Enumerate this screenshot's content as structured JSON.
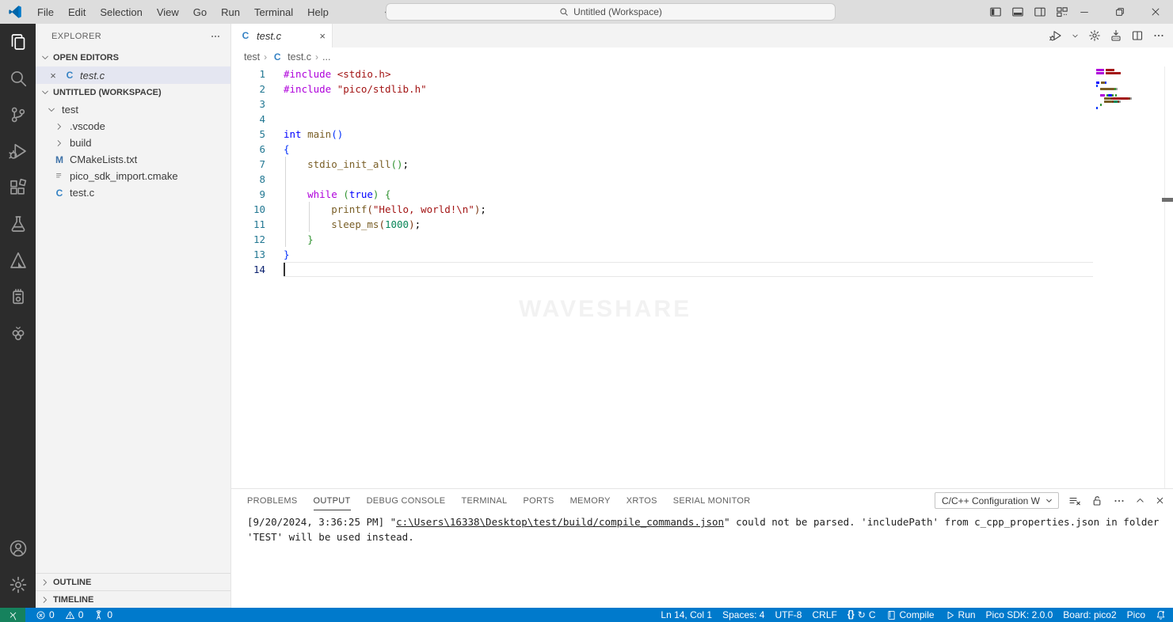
{
  "window": {
    "menus": [
      "File",
      "Edit",
      "Selection",
      "View",
      "Go",
      "Run",
      "Terminal",
      "Help"
    ],
    "search_label": "Untitled (Workspace)",
    "layout_icons": [
      "layout-sidebar-left",
      "layout-panel",
      "layout-sidebar-right",
      "layout-customize"
    ],
    "window_controls": [
      "minimize",
      "restore",
      "close"
    ]
  },
  "activity_bar": {
    "top": [
      {
        "name": "explorer",
        "icon": "files",
        "active": true
      },
      {
        "name": "search",
        "icon": "search",
        "active": false
      },
      {
        "name": "source-control",
        "icon": "git",
        "active": false
      },
      {
        "name": "run-and-debug",
        "icon": "debug",
        "active": false
      },
      {
        "name": "extensions",
        "icon": "extensions",
        "active": false
      },
      {
        "name": "testing",
        "icon": "beaker",
        "active": false
      },
      {
        "name": "cmake",
        "icon": "cmake",
        "active": false
      },
      {
        "name": "mcu-tools",
        "icon": "chip",
        "active": false
      },
      {
        "name": "raspberry-pi-pico",
        "icon": "raspberry",
        "active": false
      }
    ],
    "bottom": [
      {
        "name": "accounts",
        "icon": "account"
      },
      {
        "name": "manage",
        "icon": "gear"
      }
    ]
  },
  "sidebar": {
    "title": "EXPLORER",
    "open_editors_header": "OPEN EDITORS",
    "open_editors": [
      {
        "label": "test.c",
        "icon": "c",
        "selected": true
      }
    ],
    "workspace_header": "UNTITLED (WORKSPACE)",
    "tree": [
      {
        "label": "test",
        "type": "folder",
        "expanded": true,
        "depth": 0
      },
      {
        "label": ".vscode",
        "type": "folder",
        "expanded": false,
        "depth": 1
      },
      {
        "label": "build",
        "type": "folder",
        "expanded": false,
        "depth": 1
      },
      {
        "label": "CMakeLists.txt",
        "icon": "m",
        "depth": 1
      },
      {
        "label": "pico_sdk_import.cmake",
        "icon": "doc",
        "depth": 1
      },
      {
        "label": "test.c",
        "icon": "c",
        "depth": 1
      }
    ],
    "bottom_sections": [
      "OUTLINE",
      "TIMELINE"
    ]
  },
  "editor": {
    "tab": {
      "label": "test.c"
    },
    "toolbar_icons": [
      "debug-run",
      "chevron-down-small",
      "gear",
      "flash",
      "split-editor",
      "more"
    ],
    "breadcrumb": [
      "test",
      "test.c",
      "..."
    ],
    "watermark": "WAVESHARE",
    "syntax_colors": {
      "pp": "#af00db",
      "kw": "#0000ff",
      "fn": "#795e26",
      "str": "#a31515",
      "num": "#098658",
      "pl": "#000000",
      "b1": "#0431fa",
      "b2": "#319331",
      "b3": "#7b3814"
    },
    "lines": [
      {
        "n": 1,
        "t": [
          [
            "pp",
            "#include"
          ],
          [
            "pl",
            " "
          ],
          [
            "str",
            "<stdio.h>"
          ]
        ]
      },
      {
        "n": 2,
        "t": [
          [
            "pp",
            "#include"
          ],
          [
            "pl",
            " "
          ],
          [
            "str",
            "\"pico/stdlib.h\""
          ]
        ]
      },
      {
        "n": 3,
        "t": []
      },
      {
        "n": 4,
        "t": []
      },
      {
        "n": 5,
        "t": [
          [
            "kw",
            "int"
          ],
          [
            "pl",
            " "
          ],
          [
            "fn",
            "main"
          ],
          [
            "b1",
            "()"
          ]
        ]
      },
      {
        "n": 6,
        "t": [
          [
            "b1",
            "{"
          ]
        ]
      },
      {
        "n": 7,
        "t": [
          [
            "pl",
            "    "
          ],
          [
            "fn",
            "stdio_init_all"
          ],
          [
            "b2",
            "()"
          ],
          [
            "pl",
            ";"
          ]
        ],
        "g": [
          0
        ]
      },
      {
        "n": 8,
        "t": [],
        "g": [
          0
        ]
      },
      {
        "n": 9,
        "t": [
          [
            "pl",
            "    "
          ],
          [
            "pp",
            "while"
          ],
          [
            "pl",
            " "
          ],
          [
            "b2",
            "("
          ],
          [
            "kw",
            "true"
          ],
          [
            "b2",
            ")"
          ],
          [
            "pl",
            " "
          ],
          [
            "b2",
            "{"
          ]
        ],
        "g": [
          0
        ]
      },
      {
        "n": 10,
        "t": [
          [
            "pl",
            "        "
          ],
          [
            "fn",
            "printf"
          ],
          [
            "b3",
            "("
          ],
          [
            "str",
            "\"Hello, world!\\n\""
          ],
          [
            "b3",
            ")"
          ],
          [
            "pl",
            ";"
          ]
        ],
        "g": [
          0,
          1
        ]
      },
      {
        "n": 11,
        "t": [
          [
            "pl",
            "        "
          ],
          [
            "fn",
            "sleep_ms"
          ],
          [
            "b3",
            "("
          ],
          [
            "num",
            "1000"
          ],
          [
            "b3",
            ")"
          ],
          [
            "pl",
            ";"
          ]
        ],
        "g": [
          0,
          1
        ]
      },
      {
        "n": 12,
        "t": [
          [
            "pl",
            "    "
          ],
          [
            "b2",
            "}"
          ]
        ],
        "g": [
          0
        ]
      },
      {
        "n": 13,
        "t": [
          [
            "b1",
            "}"
          ]
        ]
      },
      {
        "n": 14,
        "t": [],
        "current": true
      }
    ]
  },
  "panel": {
    "tabs": [
      "PROBLEMS",
      "OUTPUT",
      "DEBUG CONSOLE",
      "TERMINAL",
      "PORTS",
      "MEMORY",
      "XRTOS",
      "SERIAL MONITOR"
    ],
    "active_tab": "OUTPUT",
    "dropdown_value": "C/C++ Configuration W",
    "control_icons": [
      "clear-output",
      "lock",
      "more",
      "caret-up",
      "close-panel"
    ],
    "output_lines": [
      [
        {
          "text": "[9/20/2024, 3:36:25 PM] \""
        },
        {
          "text": "c:\\Users\\16338\\Desktop\\test/build/compile_commands.json",
          "link": true
        },
        {
          "text": "\" could not be parsed. 'includePath' from c_cpp_properties.json in folder"
        }
      ],
      [
        {
          "text": "'TEST' will be used instead."
        }
      ]
    ]
  },
  "status_bar": {
    "colors": {
      "background": "#007acc",
      "remote_background": "#16825d"
    },
    "left": [
      {
        "name": "remote-indicator",
        "icon": "remote",
        "remote": true
      },
      {
        "name": "errors",
        "icon": "error",
        "text": "0"
      },
      {
        "name": "warnings",
        "icon": "warn",
        "text": "0"
      },
      {
        "name": "ports-forwarded",
        "icon": "tower",
        "text": "0"
      }
    ],
    "right": [
      {
        "name": "cursor-position",
        "text": "Ln 14, Col 1"
      },
      {
        "name": "indentation",
        "text": "Spaces: 4"
      },
      {
        "name": "encoding",
        "text": "UTF-8"
      },
      {
        "name": "eol",
        "text": "CRLF"
      },
      {
        "name": "language-mode",
        "icons": [
          "braces",
          "sync"
        ],
        "text": "C"
      },
      {
        "name": "compile-button",
        "icons": [
          "book"
        ],
        "text": "Compile"
      },
      {
        "name": "run-button",
        "icons": [
          "play"
        ],
        "text": "Run"
      },
      {
        "name": "pico-sdk-version",
        "text": "Pico SDK: 2.0.0"
      },
      {
        "name": "board",
        "text": "Board: pico2"
      },
      {
        "name": "pico",
        "text": "Pico"
      },
      {
        "name": "notifications",
        "icons": [
          "bell"
        ],
        "text": ""
      }
    ]
  }
}
